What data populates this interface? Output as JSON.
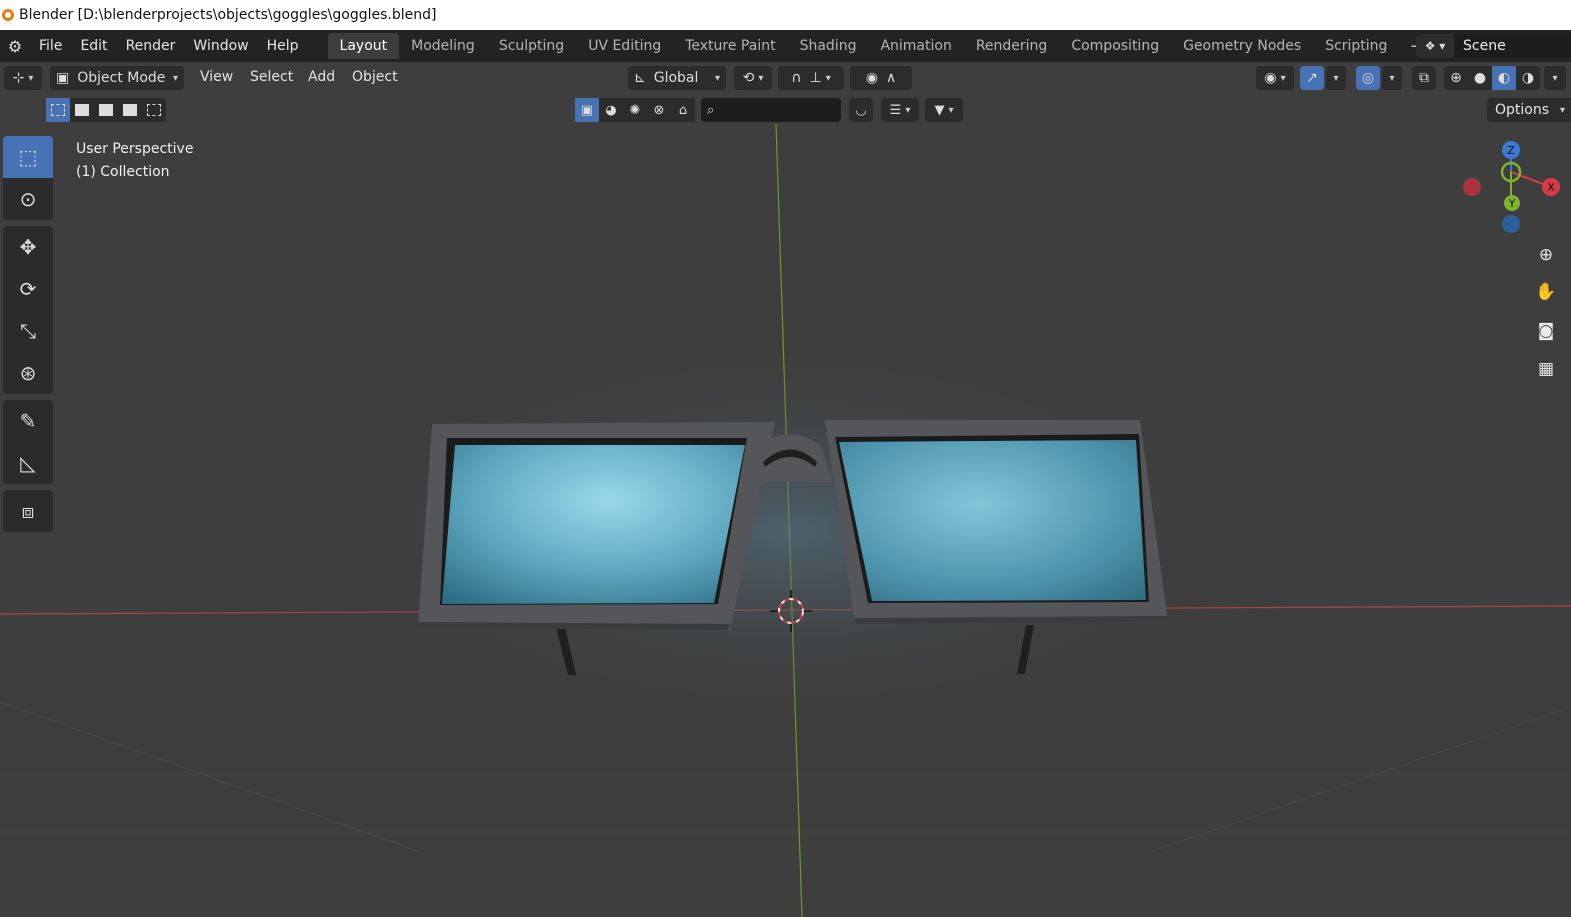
{
  "window": {
    "title": "Blender [D:\\blenderprojects\\objects\\goggles\\goggles.blend]"
  },
  "menu": {
    "file": "File",
    "edit": "Edit",
    "render": "Render",
    "window": "Window",
    "help": "Help"
  },
  "workspaces": [
    "Layout",
    "Modeling",
    "Sculpting",
    "UV Editing",
    "Texture Paint",
    "Shading",
    "Animation",
    "Rendering",
    "Compositing",
    "Geometry Nodes",
    "Scripting"
  ],
  "active_workspace": "Layout",
  "scene": {
    "name": "Scene"
  },
  "viewport_header": {
    "mode": "Object Mode",
    "view": "View",
    "select": "Select",
    "add": "Add",
    "object": "Object",
    "orientation": "Global",
    "options": "Options"
  },
  "viewport_info": {
    "perspective": "User Perspective",
    "collection": "(1) Collection"
  },
  "gizmo": {
    "z": "Z",
    "y": "Y",
    "x": "X"
  },
  "colors": {
    "accent": "#4772b3",
    "axis_x": "#d63c47",
    "axis_y": "#7fb42d",
    "axis_z": "#3b7bd4",
    "lens": "#6fb4c8"
  }
}
